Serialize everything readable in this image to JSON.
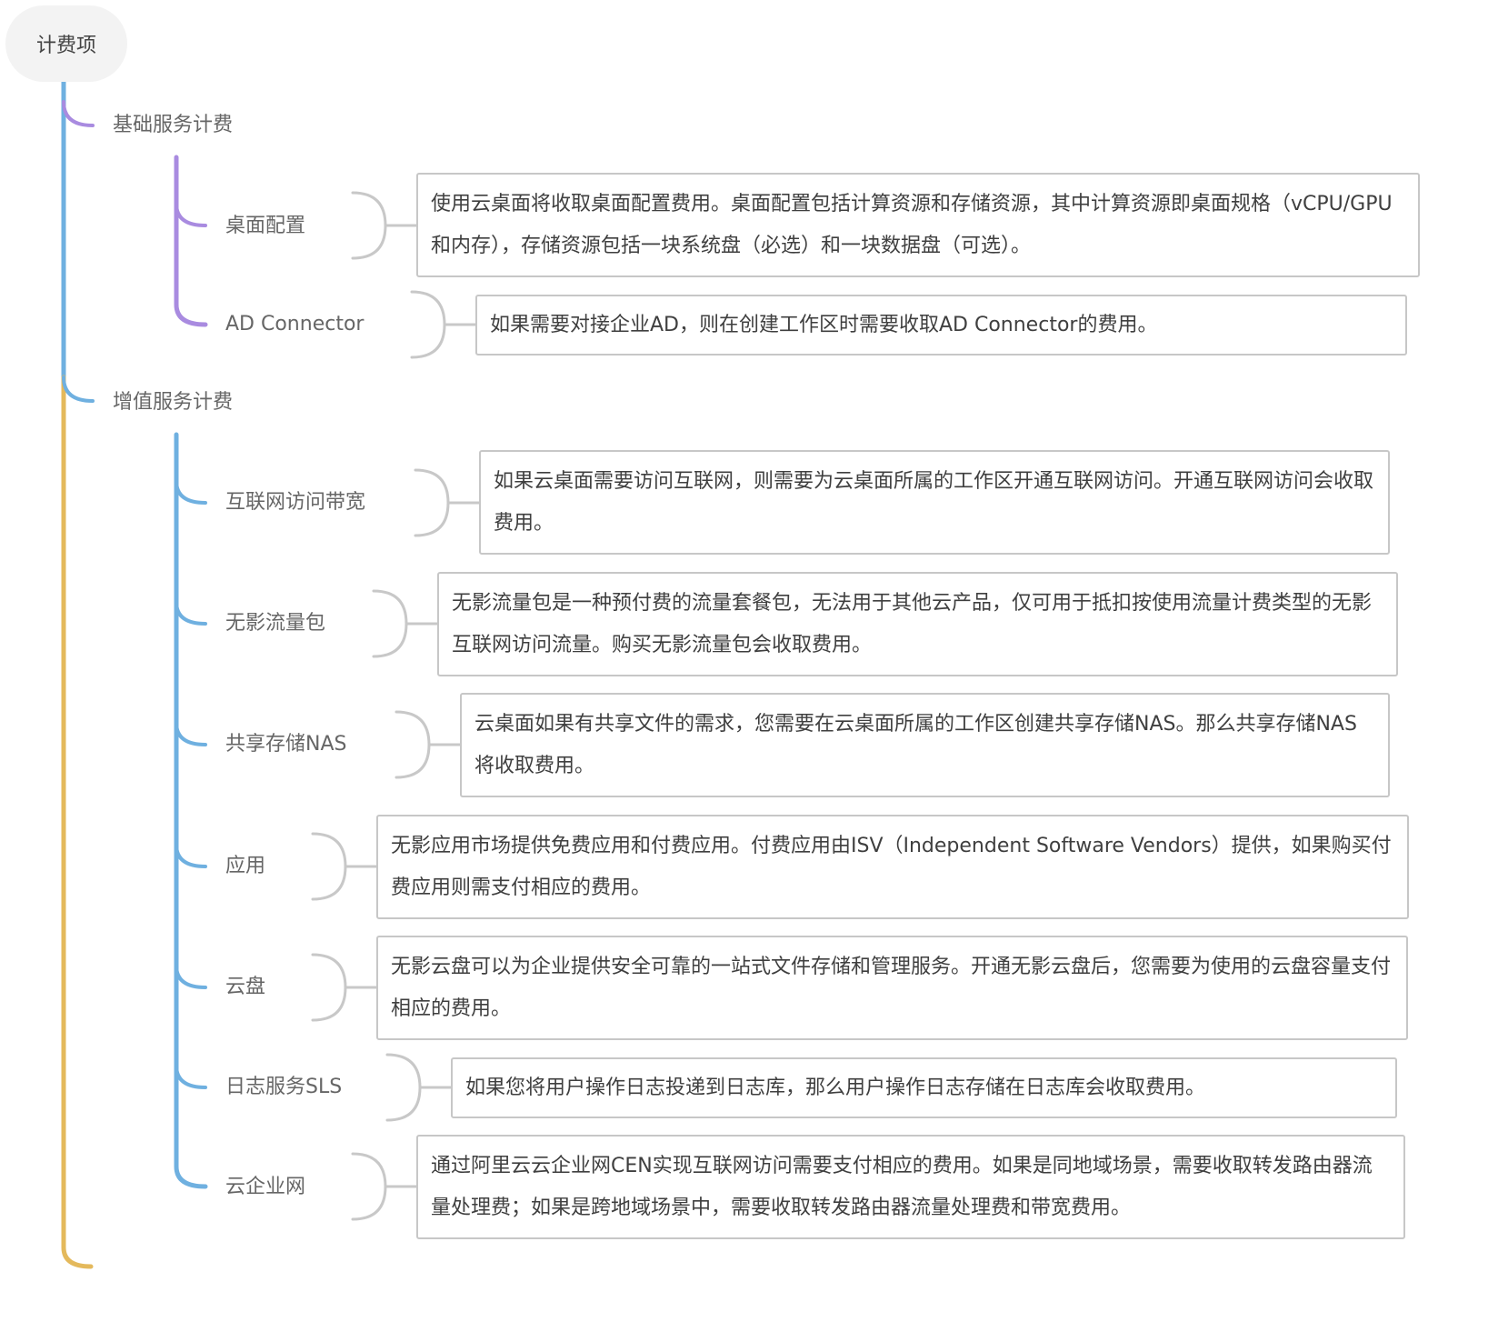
{
  "root": {
    "label": "计费项"
  },
  "colors": {
    "trunk_blue": "#6fb0e0",
    "trunk_yellow": "#e4b95c",
    "purple": "#a98be0",
    "blue": "#6fb0e0",
    "bracket_gray": "#c8c8c8",
    "box_border": "#c7c7c7"
  },
  "groups": [
    {
      "label": "基础服务计费",
      "items": [
        {
          "label": "桌面配置",
          "description": "使用云桌面将收取桌面配置费用。桌面配置包括计算资源和存储资源，其中计算资源即桌面规格（vCPU/GPU和内存），存储资源包括一块系统盘（必选）和一块数据盘（可选）。"
        },
        {
          "label": "AD Connector",
          "description": "如果需要对接企业AD，则在创建工作区时需要收取AD Connector的费用。"
        }
      ]
    },
    {
      "label": "增值服务计费",
      "items": [
        {
          "label": "互联网访问带宽",
          "description": "如果云桌面需要访问互联网，则需要为云桌面所属的工作区开通互联网访问。开通互联网访问会收取费用。"
        },
        {
          "label": "无影流量包",
          "description": "无影流量包是一种预付费的流量套餐包，无法用于其他云产品，仅可用于抵扣按使用流量计费类型的无影互联网访问流量。购买无影流量包会收取费用。"
        },
        {
          "label": "共享存储NAS",
          "description": "云桌面如果有共享文件的需求，您需要在云桌面所属的工作区创建共享存储NAS。那么共享存储NAS将收取费用。"
        },
        {
          "label": "应用",
          "description": "无影应用市场提供免费应用和付费应用。付费应用由ISV（Independent Software Vendors）提供，如果购买付费应用则需支付相应的费用。"
        },
        {
          "label": "云盘",
          "description": "无影云盘可以为企业提供安全可靠的一站式文件存储和管理服务。开通无影云盘后，您需要为使用的云盘容量支付相应的费用。"
        },
        {
          "label": "日志服务SLS",
          "description": "如果您将用户操作日志投递到日志库，那么用户操作日志存储在日志库会收取费用。"
        },
        {
          "label": "云企业网",
          "description": "通过阿里云云企业网CEN实现互联网访问需要支付相应的费用。如果是同地域场景，需要收取转发路由器流量处理费；如果是跨地域场景中，需要收取转发路由器流量处理费和带宽费用。"
        }
      ]
    }
  ]
}
